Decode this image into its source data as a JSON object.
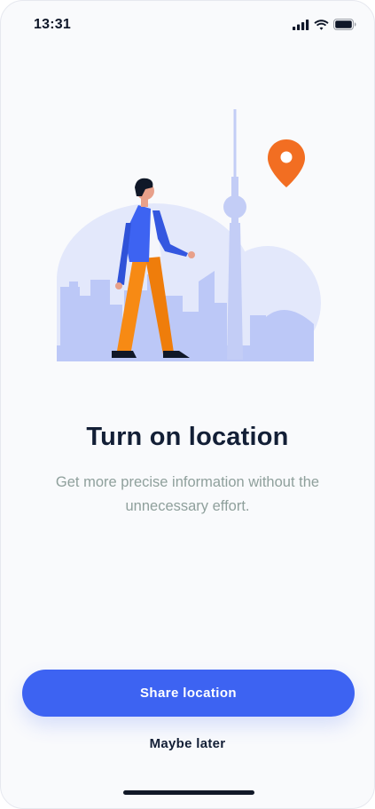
{
  "status_bar": {
    "time": "13:31",
    "icons": [
      "cellular-signal-icon",
      "wifi-icon",
      "battery-icon"
    ]
  },
  "illustration": {
    "name": "city-walker-illustration",
    "colors": {
      "sky_blob": "#e3e8fb",
      "buildings": "#bcc8f7",
      "pin": "#f26e22",
      "jacket": "#3d63f2",
      "trousers": "#f78a14"
    }
  },
  "main": {
    "title": "Turn on location",
    "subtitle": "Get more precise information without the unnecessary effort."
  },
  "actions": {
    "primary_label": "Share location",
    "secondary_label": "Maybe later"
  },
  "theme": {
    "accent": "#3d63f2",
    "background": "#f9fafc",
    "text_dark": "#131f36",
    "text_muted": "#8fa09c"
  }
}
